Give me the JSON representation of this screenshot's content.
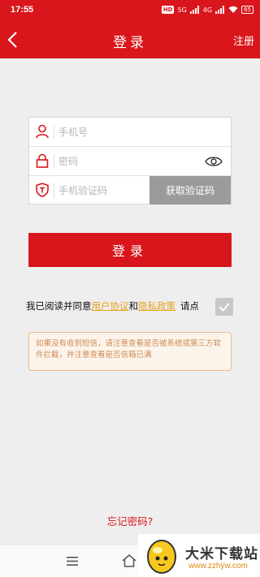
{
  "status_bar": {
    "time": "17:55",
    "hd_badge": "HD",
    "network_5g": "5G",
    "network_4g": "4G",
    "battery": "65"
  },
  "nav": {
    "title": "登录",
    "register": "注册"
  },
  "form": {
    "phone_placeholder": "手机号",
    "password_placeholder": "密码",
    "code_placeholder": "手机验证码",
    "get_code_button": "获取验证码"
  },
  "login_button": "登录",
  "agreement": {
    "prefix": "我已阅读并同意",
    "user_agreement": "用户协议",
    "and": "和",
    "privacy_policy": "隐私政策",
    "suffix": "请点"
  },
  "notice": "如果没有收到短信，请注意查看是否被系统或第三方软件拦截，并注意查看是否信箱已满",
  "forgot_password": "忘记密码?",
  "watermark": {
    "title": "大米下载站",
    "url": "www.zzhyw.com"
  },
  "colors": {
    "brand_red": "#d9161c",
    "link_orange": "#e6a11a",
    "code_button_gray": "#9b9b9b"
  }
}
